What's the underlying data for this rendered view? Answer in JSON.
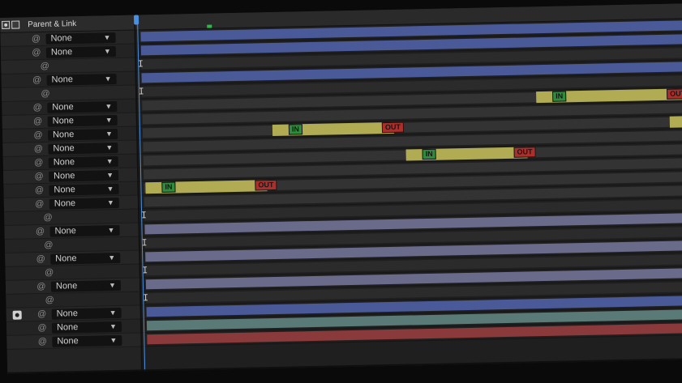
{
  "header": {
    "title": "Parent & Link"
  },
  "dropdown_value": "None",
  "rows": [
    {
      "kind": "control"
    },
    {
      "kind": "control"
    },
    {
      "kind": "spacer"
    },
    {
      "kind": "control"
    },
    {
      "kind": "spacer"
    },
    {
      "kind": "control"
    },
    {
      "kind": "control"
    },
    {
      "kind": "control"
    },
    {
      "kind": "control"
    },
    {
      "kind": "control"
    },
    {
      "kind": "control"
    },
    {
      "kind": "control"
    },
    {
      "kind": "control"
    },
    {
      "kind": "spacer"
    },
    {
      "kind": "control"
    },
    {
      "kind": "spacer"
    },
    {
      "kind": "control"
    },
    {
      "kind": "spacer"
    },
    {
      "kind": "control"
    },
    {
      "kind": "spacer"
    },
    {
      "kind": "control"
    },
    {
      "kind": "control"
    },
    {
      "kind": "control"
    }
  ],
  "labels": {
    "in": "IN",
    "out": "OUT"
  },
  "colors": {
    "blue": "#4a5a99",
    "lavender": "#6a6a8a",
    "gray": "#4e4e58",
    "yellow": "#c8c25a",
    "teal": "#5a7a78",
    "red": "#8a3a3a",
    "playhead": "#4a8fe0"
  }
}
